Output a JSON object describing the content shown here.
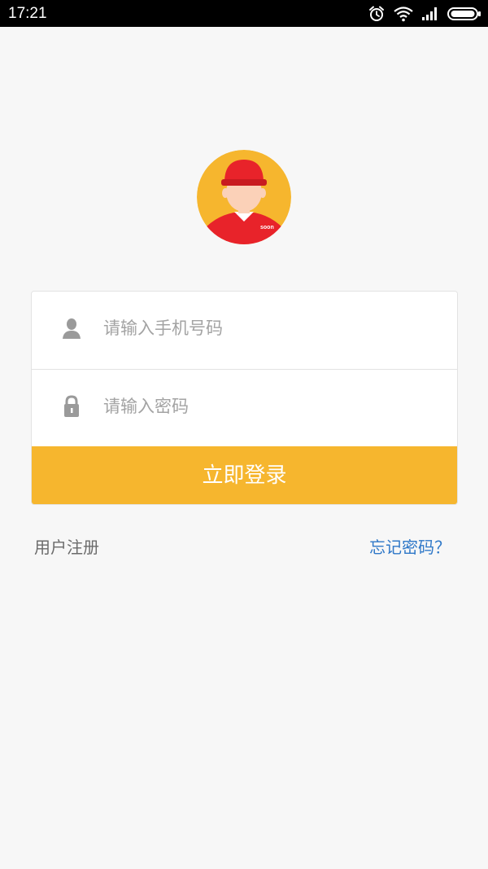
{
  "status_bar": {
    "time": "17:21",
    "icons": [
      "alarm-icon",
      "wifi-icon",
      "signal-icon",
      "battery-icon"
    ]
  },
  "avatar": {
    "badge_text": "soon",
    "colors": {
      "background": "#f6b62e",
      "cap": "#e8232a",
      "shirt": "#e8232a",
      "skin": "#fbd1b8"
    }
  },
  "login_form": {
    "phone_placeholder": "请输入手机号码",
    "password_placeholder": "请输入密码",
    "phone_icon": "user-icon",
    "password_icon": "lock-icon",
    "submit_label": "立即登录"
  },
  "links": {
    "register": "用户注册",
    "forgot_password": "忘记密码？"
  },
  "colors": {
    "accent": "#f6b62e",
    "link": "#2f78c8",
    "background": "#f7f7f7"
  }
}
